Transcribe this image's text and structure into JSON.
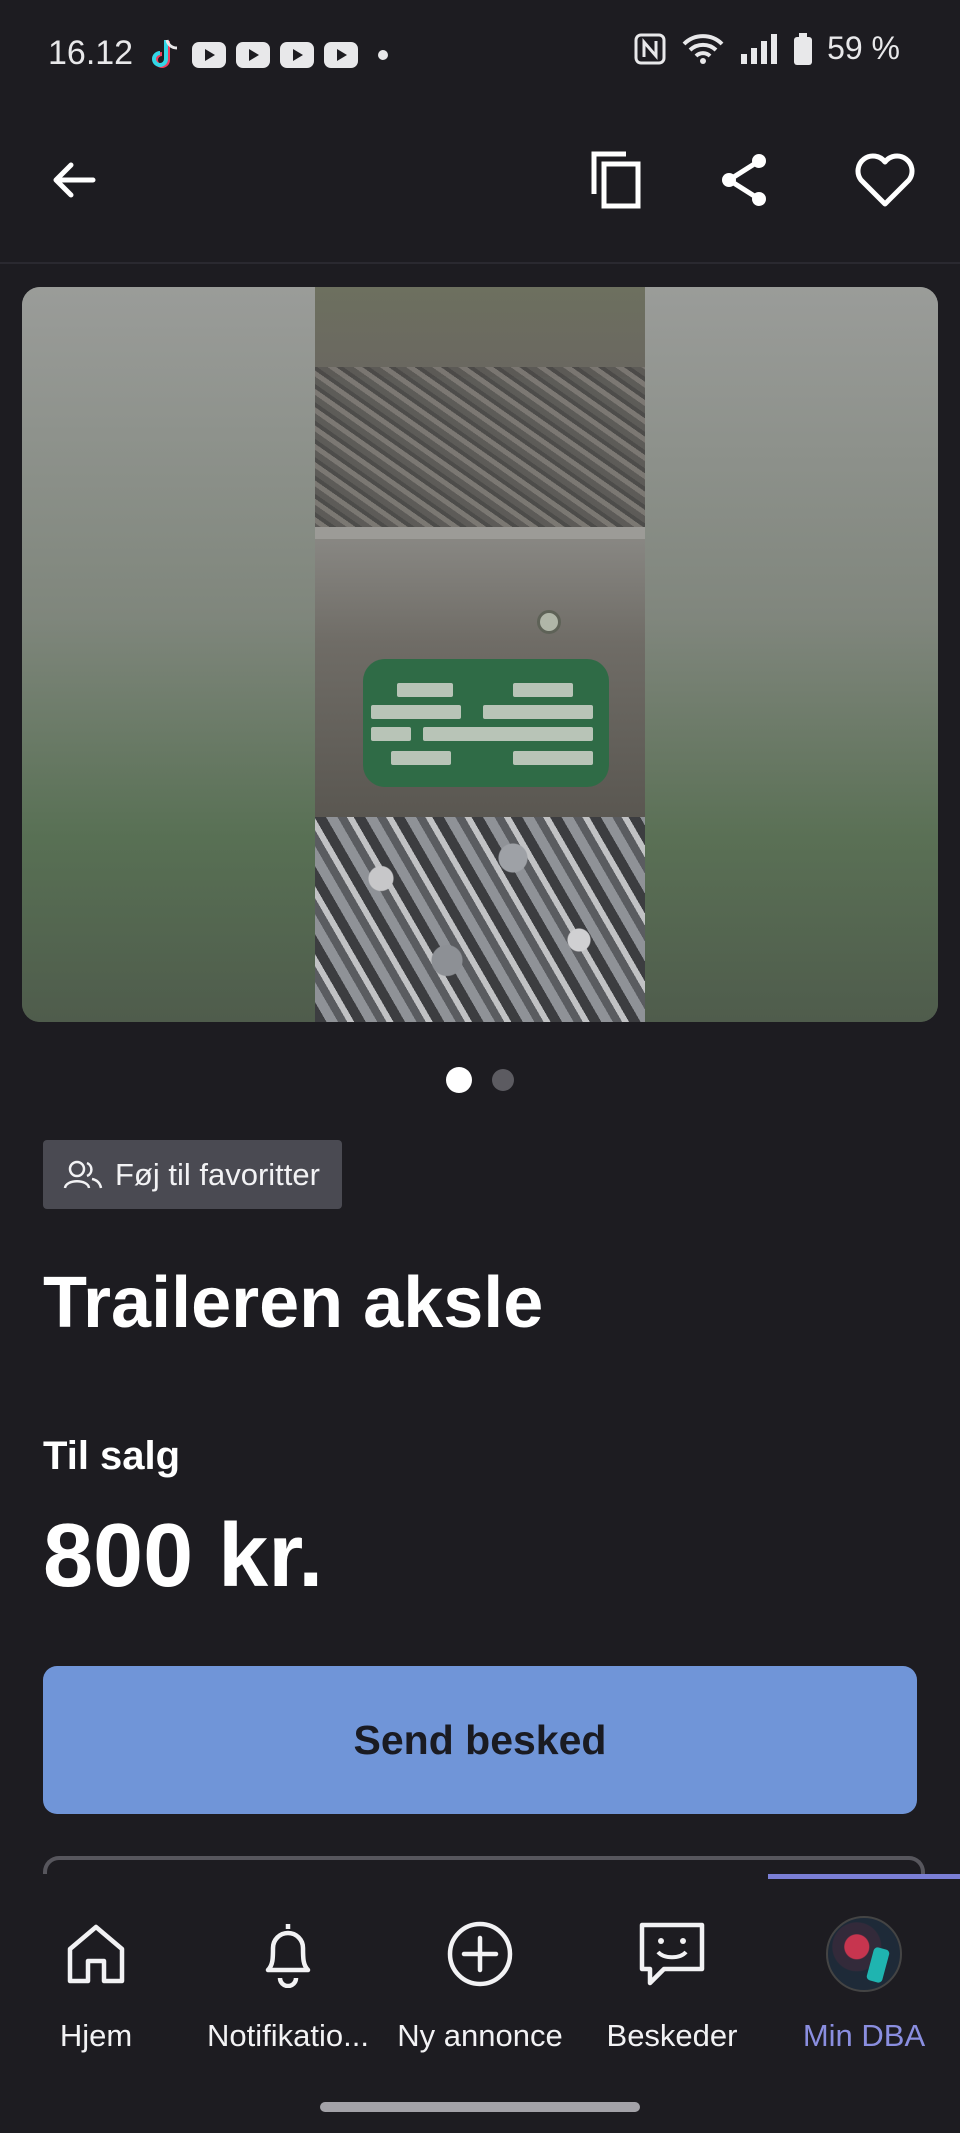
{
  "status_bar": {
    "time": "16.12",
    "battery": "59 %",
    "icons": [
      "tiktok-icon",
      "youtube-icon",
      "youtube-icon",
      "youtube-icon",
      "youtube-icon",
      "notification-dot-icon",
      "nfc-icon",
      "wifi-icon",
      "signal-icon",
      "battery-icon"
    ]
  },
  "app_bar": {
    "icons": [
      "back-arrow-icon",
      "copy-icon",
      "share-icon",
      "heart-icon"
    ]
  },
  "gallery": {
    "page_count": 2,
    "current_page": 1
  },
  "listing": {
    "favorite_chip_label": "Føj til favoritter",
    "title": "Traileren aksle",
    "type_label": "Til salg",
    "price": "800 kr.",
    "send_button_label": "Send besked"
  },
  "bottom_nav": {
    "items": [
      {
        "label": "Hjem",
        "icon": "home-icon"
      },
      {
        "label": "Notifikatio...",
        "icon": "bell-icon"
      },
      {
        "label": "Ny annonce",
        "icon": "plus-circle-icon"
      },
      {
        "label": "Beskeder",
        "icon": "message-icon"
      },
      {
        "label": "Min DBA",
        "icon": "avatar"
      }
    ],
    "active_index": 4,
    "active_color": "#8a8ee0"
  },
  "colors": {
    "background": "#1d1c21",
    "primary_button": "#7095d8",
    "chip_background": "#4a4a52"
  }
}
